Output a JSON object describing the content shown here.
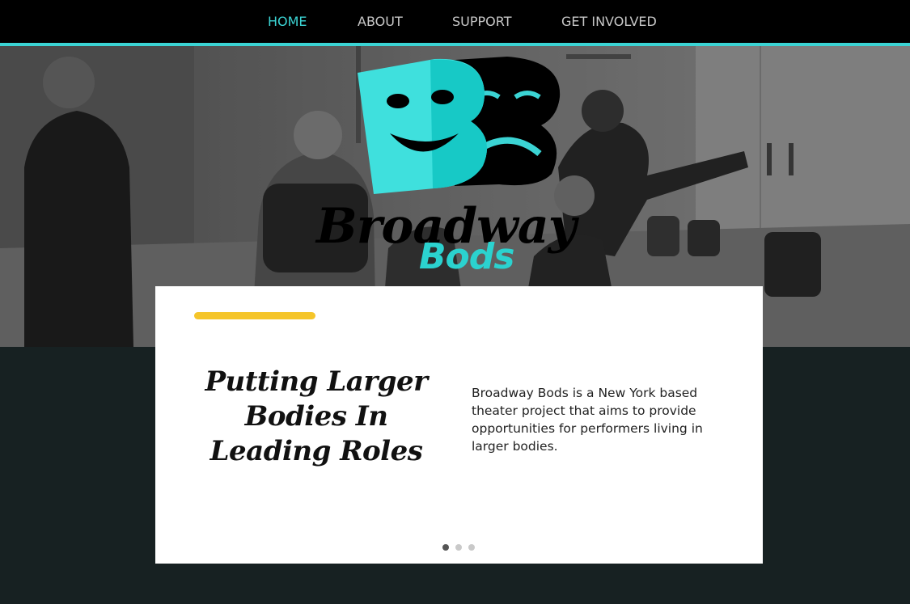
{
  "nav": {
    "items": [
      {
        "label": "HOME",
        "active": true
      },
      {
        "label": "ABOUT",
        "active": false
      },
      {
        "label": "SUPPORT",
        "active": false
      },
      {
        "label": "GET INVOLVED",
        "active": false
      }
    ]
  },
  "logo": {
    "line1": "Broadway",
    "line2": "Bods",
    "mark": "BB"
  },
  "slide": {
    "headline_lines": [
      "Putting Larger",
      "Bodies In",
      "Leading Roles"
    ],
    "description": "Broadway Bods is a New York based theater project that aims to provide opportunities for performers living in larger bodies.",
    "total_slides": 3,
    "active_slide": 1
  },
  "colors": {
    "nav_bg": "#000000",
    "accent_teal": "#3bd4d4",
    "accent_yellow": "#f5c52a",
    "page_bg": "#172122",
    "card_bg": "#ffffff"
  },
  "hero": {
    "image": "grayscale-rehearsal-photo",
    "logo_icon": "theater-masks-bb-logo"
  }
}
